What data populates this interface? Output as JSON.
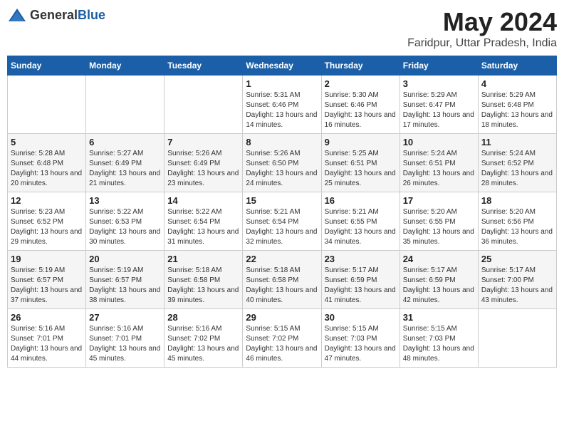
{
  "header": {
    "logo_general": "General",
    "logo_blue": "Blue",
    "title": "May 2024",
    "subtitle": "Faridpur, Uttar Pradesh, India"
  },
  "calendar": {
    "days_of_week": [
      "Sunday",
      "Monday",
      "Tuesday",
      "Wednesday",
      "Thursday",
      "Friday",
      "Saturday"
    ],
    "weeks": [
      [
        {
          "day": "",
          "info": ""
        },
        {
          "day": "",
          "info": ""
        },
        {
          "day": "",
          "info": ""
        },
        {
          "day": "1",
          "info": "Sunrise: 5:31 AM\nSunset: 6:46 PM\nDaylight: 13 hours\nand 14 minutes."
        },
        {
          "day": "2",
          "info": "Sunrise: 5:30 AM\nSunset: 6:46 PM\nDaylight: 13 hours\nand 16 minutes."
        },
        {
          "day": "3",
          "info": "Sunrise: 5:29 AM\nSunset: 6:47 PM\nDaylight: 13 hours\nand 17 minutes."
        },
        {
          "day": "4",
          "info": "Sunrise: 5:29 AM\nSunset: 6:48 PM\nDaylight: 13 hours\nand 18 minutes."
        }
      ],
      [
        {
          "day": "5",
          "info": "Sunrise: 5:28 AM\nSunset: 6:48 PM\nDaylight: 13 hours\nand 20 minutes."
        },
        {
          "day": "6",
          "info": "Sunrise: 5:27 AM\nSunset: 6:49 PM\nDaylight: 13 hours\nand 21 minutes."
        },
        {
          "day": "7",
          "info": "Sunrise: 5:26 AM\nSunset: 6:49 PM\nDaylight: 13 hours\nand 23 minutes."
        },
        {
          "day": "8",
          "info": "Sunrise: 5:26 AM\nSunset: 6:50 PM\nDaylight: 13 hours\nand 24 minutes."
        },
        {
          "day": "9",
          "info": "Sunrise: 5:25 AM\nSunset: 6:51 PM\nDaylight: 13 hours\nand 25 minutes."
        },
        {
          "day": "10",
          "info": "Sunrise: 5:24 AM\nSunset: 6:51 PM\nDaylight: 13 hours\nand 26 minutes."
        },
        {
          "day": "11",
          "info": "Sunrise: 5:24 AM\nSunset: 6:52 PM\nDaylight: 13 hours\nand 28 minutes."
        }
      ],
      [
        {
          "day": "12",
          "info": "Sunrise: 5:23 AM\nSunset: 6:52 PM\nDaylight: 13 hours\nand 29 minutes."
        },
        {
          "day": "13",
          "info": "Sunrise: 5:22 AM\nSunset: 6:53 PM\nDaylight: 13 hours\nand 30 minutes."
        },
        {
          "day": "14",
          "info": "Sunrise: 5:22 AM\nSunset: 6:54 PM\nDaylight: 13 hours\nand 31 minutes."
        },
        {
          "day": "15",
          "info": "Sunrise: 5:21 AM\nSunset: 6:54 PM\nDaylight: 13 hours\nand 32 minutes."
        },
        {
          "day": "16",
          "info": "Sunrise: 5:21 AM\nSunset: 6:55 PM\nDaylight: 13 hours\nand 34 minutes."
        },
        {
          "day": "17",
          "info": "Sunrise: 5:20 AM\nSunset: 6:55 PM\nDaylight: 13 hours\nand 35 minutes."
        },
        {
          "day": "18",
          "info": "Sunrise: 5:20 AM\nSunset: 6:56 PM\nDaylight: 13 hours\nand 36 minutes."
        }
      ],
      [
        {
          "day": "19",
          "info": "Sunrise: 5:19 AM\nSunset: 6:57 PM\nDaylight: 13 hours\nand 37 minutes."
        },
        {
          "day": "20",
          "info": "Sunrise: 5:19 AM\nSunset: 6:57 PM\nDaylight: 13 hours\nand 38 minutes."
        },
        {
          "day": "21",
          "info": "Sunrise: 5:18 AM\nSunset: 6:58 PM\nDaylight: 13 hours\nand 39 minutes."
        },
        {
          "day": "22",
          "info": "Sunrise: 5:18 AM\nSunset: 6:58 PM\nDaylight: 13 hours\nand 40 minutes."
        },
        {
          "day": "23",
          "info": "Sunrise: 5:17 AM\nSunset: 6:59 PM\nDaylight: 13 hours\nand 41 minutes."
        },
        {
          "day": "24",
          "info": "Sunrise: 5:17 AM\nSunset: 6:59 PM\nDaylight: 13 hours\nand 42 minutes."
        },
        {
          "day": "25",
          "info": "Sunrise: 5:17 AM\nSunset: 7:00 PM\nDaylight: 13 hours\nand 43 minutes."
        }
      ],
      [
        {
          "day": "26",
          "info": "Sunrise: 5:16 AM\nSunset: 7:01 PM\nDaylight: 13 hours\nand 44 minutes."
        },
        {
          "day": "27",
          "info": "Sunrise: 5:16 AM\nSunset: 7:01 PM\nDaylight: 13 hours\nand 45 minutes."
        },
        {
          "day": "28",
          "info": "Sunrise: 5:16 AM\nSunset: 7:02 PM\nDaylight: 13 hours\nand 45 minutes."
        },
        {
          "day": "29",
          "info": "Sunrise: 5:15 AM\nSunset: 7:02 PM\nDaylight: 13 hours\nand 46 minutes."
        },
        {
          "day": "30",
          "info": "Sunrise: 5:15 AM\nSunset: 7:03 PM\nDaylight: 13 hours\nand 47 minutes."
        },
        {
          "day": "31",
          "info": "Sunrise: 5:15 AM\nSunset: 7:03 PM\nDaylight: 13 hours\nand 48 minutes."
        },
        {
          "day": "",
          "info": ""
        }
      ]
    ]
  }
}
